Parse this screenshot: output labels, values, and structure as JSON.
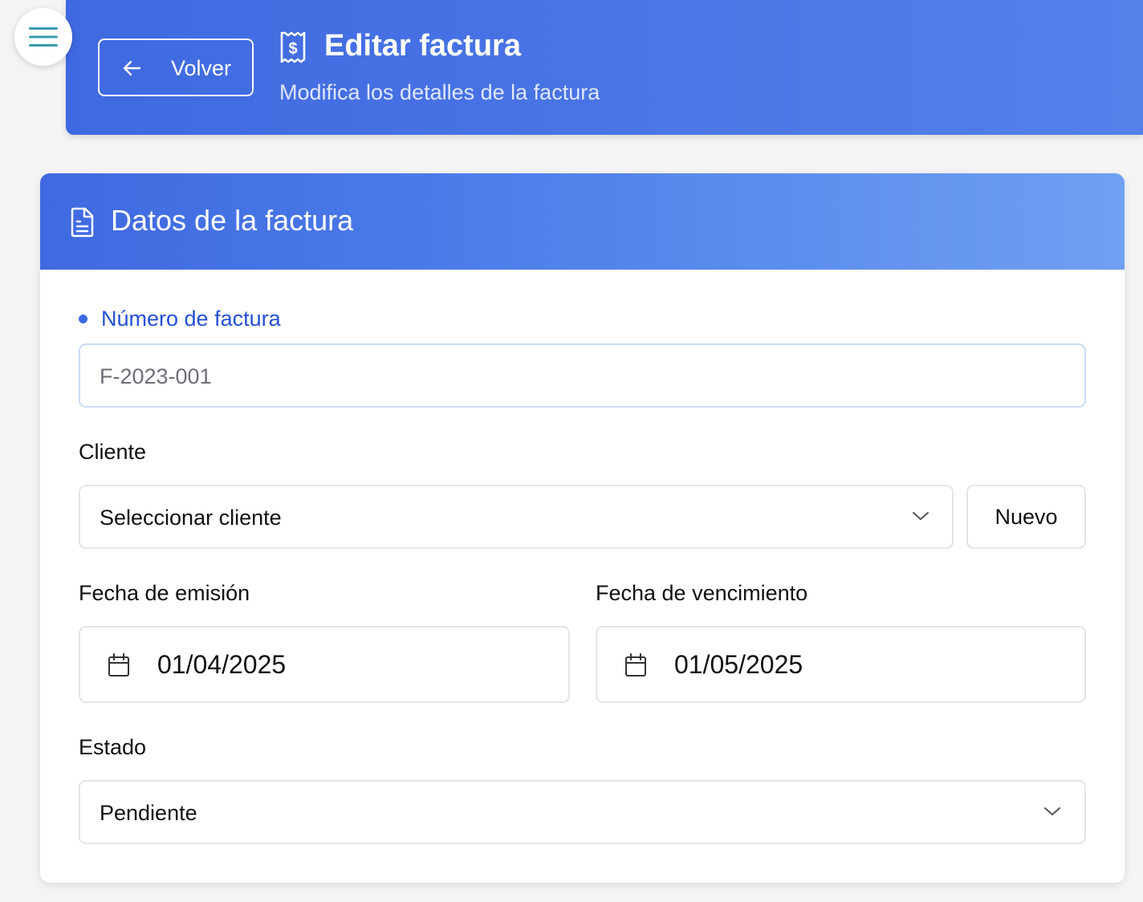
{
  "header": {
    "back_label": "Volver",
    "title": "Editar factura",
    "subtitle": "Modifica los detalles de la factura"
  },
  "card": {
    "title": "Datos de la factura"
  },
  "form": {
    "invoice_number": {
      "label": "Número de factura",
      "value": "F-2023-001"
    },
    "client": {
      "label": "Cliente",
      "selected": "Seleccionar cliente",
      "new_label": "Nuevo"
    },
    "issue_date": {
      "label": "Fecha de emisión",
      "value": "01/04/2025"
    },
    "due_date": {
      "label": "Fecha de vencimiento",
      "value": "01/05/2025"
    },
    "status": {
      "label": "Estado",
      "selected": "Pendiente"
    }
  },
  "icons": {
    "menu": "hamburger-menu-icon",
    "back": "arrow-left-icon",
    "header": "receipt-dollar-icon",
    "card": "document-icon",
    "select": "chevron-down-icon",
    "date": "calendar-icon"
  },
  "colors": {
    "primary": "#3f69e0",
    "accent_blue_text": "#2550d6",
    "menu_icon": "#3a9bb0"
  }
}
